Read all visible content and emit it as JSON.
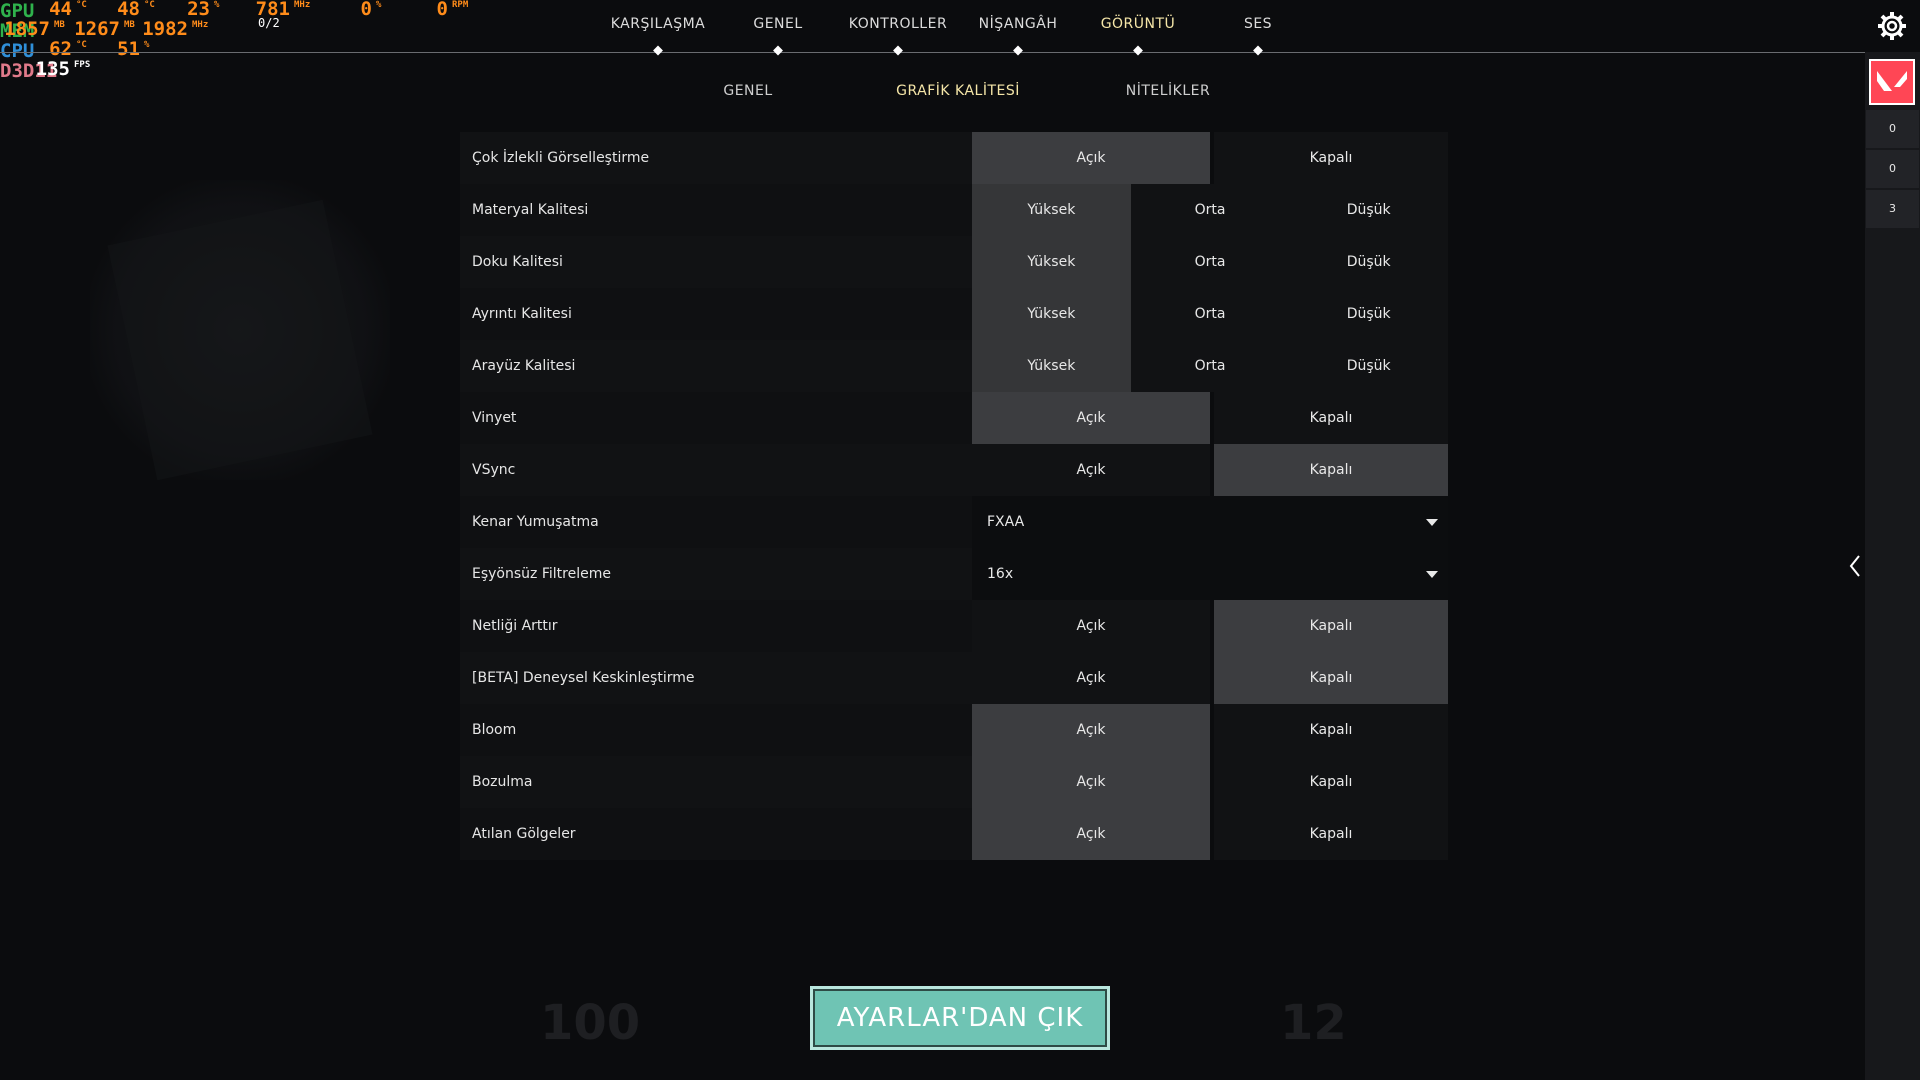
{
  "osd": {
    "rows": [
      {
        "label": "GPU",
        "color": "#2fb24c",
        "values": [
          {
            "v": "44",
            "u": "°C"
          },
          {
            "v": "48",
            "u": "°C"
          },
          {
            "v": "23",
            "u": "%"
          },
          {
            "v": "781",
            "u": "MHz"
          },
          {
            "v": "0",
            "u": "%"
          },
          {
            "v": "0",
            "u": "RPM"
          }
        ]
      },
      {
        "label": "MEM",
        "color": "#2fb24c",
        "values": [
          {
            "v": "1857",
            "u": "MB"
          },
          {
            "v": "1267",
            "u": "MB"
          },
          {
            "v": "1982",
            "u": "MHz"
          }
        ]
      },
      {
        "label": "CPU",
        "color": "#2f8fd8",
        "values": [
          {
            "v": "62",
            "u": "°C"
          },
          {
            "v": "51",
            "u": "%"
          }
        ]
      },
      {
        "label": "D3D11",
        "color": "#e07a8a",
        "values": [
          {
            "v": "135",
            "u": "FPS"
          }
        ]
      }
    ],
    "extra": "0/2"
  },
  "nav": {
    "items": [
      {
        "label": "KARŞILAŞMA",
        "active": false
      },
      {
        "label": "GENEL",
        "active": false
      },
      {
        "label": "KONTROLLER",
        "active": false
      },
      {
        "label": "NİŞANGÂH",
        "active": false
      },
      {
        "label": "GÖRÜNTÜ",
        "active": true
      },
      {
        "label": "SES",
        "active": false
      }
    ]
  },
  "subnav": {
    "items": [
      {
        "label": "GENEL",
        "active": false
      },
      {
        "label": "GRAFİK KALİTESİ",
        "active": true
      },
      {
        "label": "NİTELİKLER",
        "active": false
      }
    ]
  },
  "settings": [
    {
      "label": "Çok İzlekli Görselleştirme",
      "type": "toggle",
      "options": [
        "Açık",
        "Kapalı"
      ],
      "selected": 0
    },
    {
      "label": "Materyal Kalitesi",
      "type": "triple",
      "options": [
        "Yüksek",
        "Orta",
        "Düşük"
      ],
      "selected": 0
    },
    {
      "label": "Doku Kalitesi",
      "type": "triple",
      "options": [
        "Yüksek",
        "Orta",
        "Düşük"
      ],
      "selected": 0
    },
    {
      "label": "Ayrıntı Kalitesi",
      "type": "triple",
      "options": [
        "Yüksek",
        "Orta",
        "Düşük"
      ],
      "selected": 0
    },
    {
      "label": "Arayüz Kalitesi",
      "type": "triple",
      "options": [
        "Yüksek",
        "Orta",
        "Düşük"
      ],
      "selected": 0
    },
    {
      "label": "Vinyet",
      "type": "toggle",
      "options": [
        "Açık",
        "Kapalı"
      ],
      "selected": 0
    },
    {
      "label": "VSync",
      "type": "toggle",
      "options": [
        "Açık",
        "Kapalı"
      ],
      "selected": 1
    },
    {
      "label": "Kenar Yumuşatma",
      "type": "dropdown",
      "value": "FXAA"
    },
    {
      "label": "Eşyönsüz Filtreleme",
      "type": "dropdown",
      "value": "16x"
    },
    {
      "label": "Netliği Arttır",
      "type": "toggle",
      "options": [
        "Açık",
        "Kapalı"
      ],
      "selected": 1
    },
    {
      "label": "[BETA] Deneysel Keskinleştirme",
      "type": "toggle",
      "options": [
        "Açık",
        "Kapalı"
      ],
      "selected": 1
    },
    {
      "label": "Bloom",
      "type": "toggle",
      "options": [
        "Açık",
        "Kapalı"
      ],
      "selected": 0
    },
    {
      "label": "Bozulma",
      "type": "toggle",
      "options": [
        "Açık",
        "Kapalı"
      ],
      "selected": 0
    },
    {
      "label": "Atılan Gölgeler",
      "type": "toggle",
      "options": [
        "Açık",
        "Kapalı"
      ],
      "selected": 0
    }
  ],
  "sidebar": {
    "stats": [
      "0",
      "0",
      "3"
    ]
  },
  "exit_button": {
    "label": "AYARLAR'DAN ÇIK"
  },
  "colors": {
    "accent": "#6fc4b4",
    "active_tab": "#f5e6a8",
    "brand": "#ff4655"
  }
}
